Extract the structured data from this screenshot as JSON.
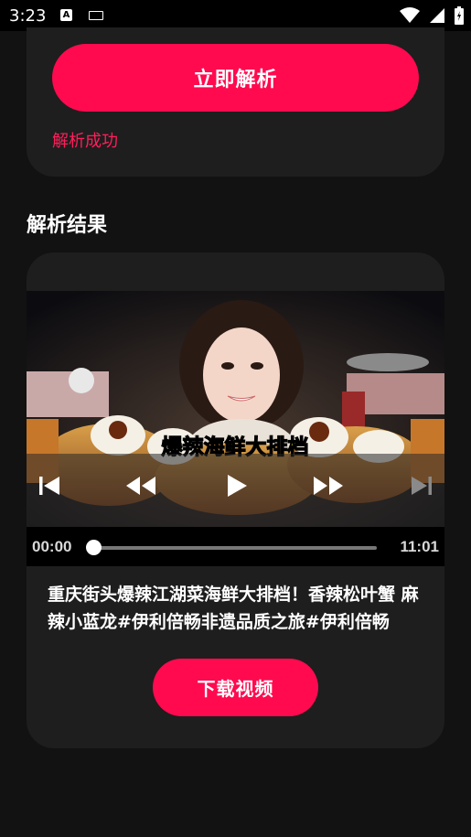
{
  "status_bar": {
    "time": "3:23",
    "icons": [
      "accessibility-a-icon",
      "keyboard-icon",
      "wifi-icon",
      "signal-icon",
      "battery-icon"
    ]
  },
  "parse_card": {
    "button_label": "立即解析",
    "status": "解析成功"
  },
  "results": {
    "section_title": "解析结果",
    "video": {
      "caption_overlay": "爆辣海鲜大排档",
      "current_time": "00:00",
      "total_time": "11:01",
      "progress": 0.0,
      "controls": [
        "skip-previous-icon",
        "rewind-icon",
        "play-icon",
        "fast-forward-icon",
        "skip-next-icon"
      ]
    },
    "title": "重庆街头爆辣江湖菜海鲜大排档！香辣松叶蟹 麻辣小蓝龙#伊利倍畅非遗品质之旅#伊利倍畅",
    "download_label": "下载视频"
  },
  "colors": {
    "accent": "#ff0a4f",
    "background": "#121212",
    "card": "#1e1e1e"
  }
}
